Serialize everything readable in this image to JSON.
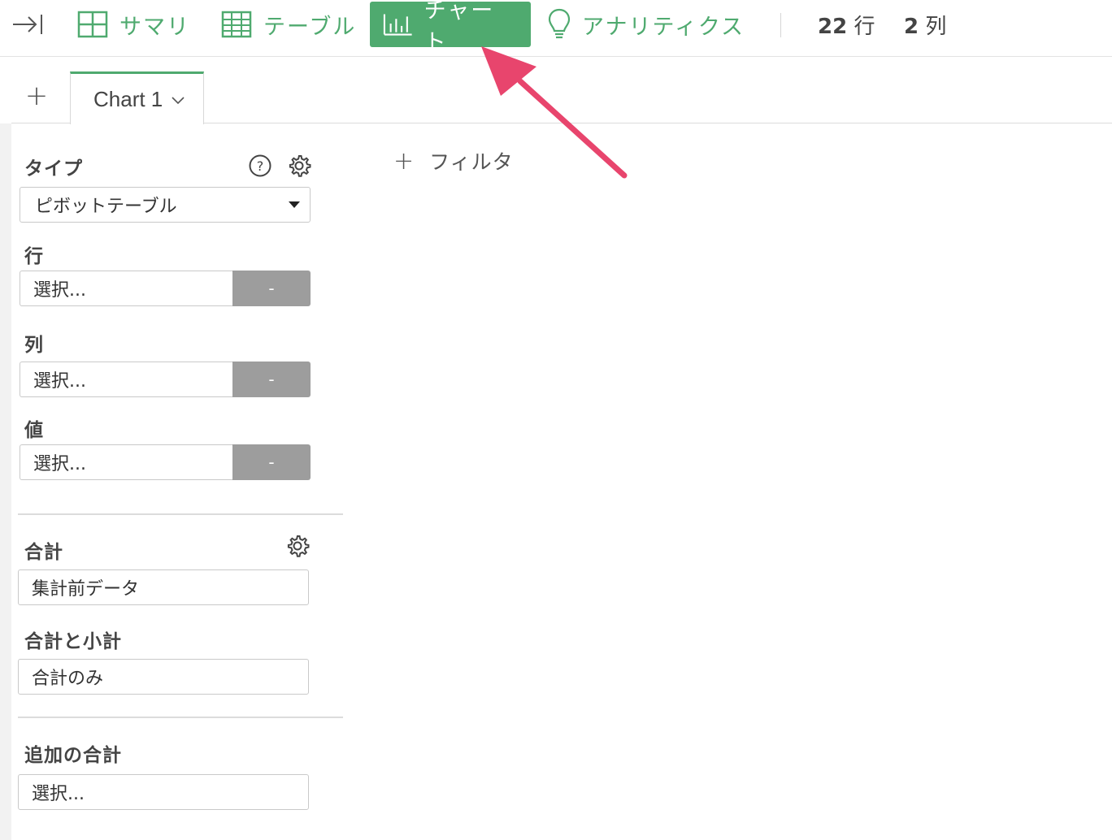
{
  "toolbar": {
    "nav": {
      "summary": "サマリ",
      "table": "テーブル",
      "chart": "チャート",
      "analytics": "アナリティクス"
    },
    "rows_count": "22",
    "rows_unit": "行",
    "cols_count": "2",
    "cols_unit": "列",
    "accent_color": "#4faa6f"
  },
  "tabs": {
    "add_label": "+",
    "items": [
      {
        "label": "Chart 1",
        "active": true
      }
    ]
  },
  "panel": {
    "type_label": "タイプ",
    "type_value": "ピボットテーブル",
    "row_label": "行",
    "row_value": "選択...",
    "row_button": "-",
    "col_label": "列",
    "col_value": "選択...",
    "col_button": "-",
    "value_label": "値",
    "value_value": "選択...",
    "value_button": "-",
    "total_label": "合計",
    "total_value": "集計前データ",
    "subtotal_label": "合計と小計",
    "subtotal_value": "合計のみ",
    "extra_label": "追加の合計",
    "extra_value": "選択..."
  },
  "main": {
    "filter_label": "フィルタ"
  },
  "annotation": {
    "arrow_color": "#e8456d"
  }
}
